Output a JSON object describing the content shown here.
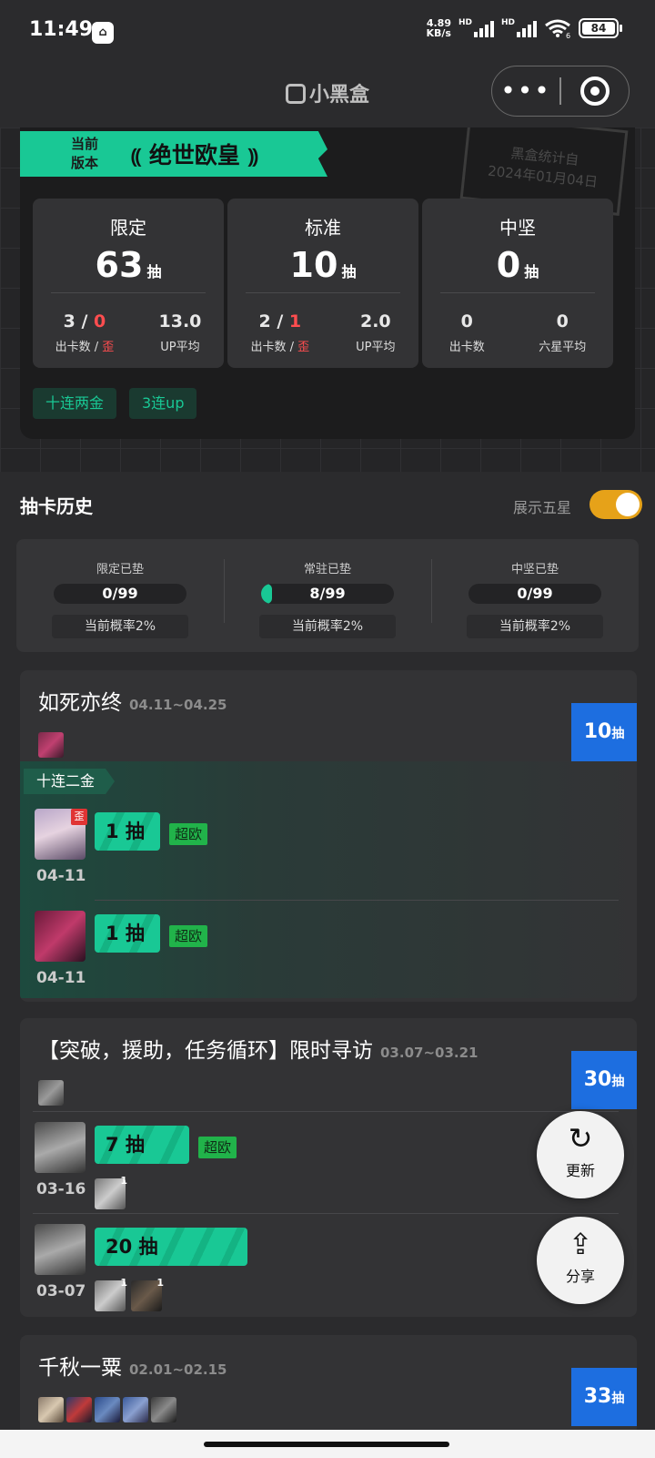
{
  "status_bar": {
    "time": "11:49",
    "app_icon": "小黑盒-icon",
    "net_speed_value": "4.89",
    "net_speed_unit": "KB/s",
    "signal_label_1": "HD",
    "signal_label_2": "HD",
    "wifi_suffix": "6",
    "battery": "84"
  },
  "nav": {
    "title": "小黑盒",
    "more_label": "•••"
  },
  "hero": {
    "stamp_line1": "黑盒统计自",
    "stamp_line2": "2024年01月04日",
    "version_label_1": "当前",
    "version_label_2": "版本",
    "version_title": "绝世欧皇",
    "cards": [
      {
        "name": "限定",
        "count": "63",
        "unit": "抽",
        "left_num_a": "3",
        "left_sep": " / ",
        "left_num_b": "0",
        "left_label_a": "出卡数 / ",
        "left_label_b": "歪",
        "right_num": "13.0",
        "right_label": "UP平均"
      },
      {
        "name": "标准",
        "count": "10",
        "unit": "抽",
        "left_num_a": "2",
        "left_sep": " / ",
        "left_num_b": "1",
        "left_label_a": "出卡数 / ",
        "left_label_b": "歪",
        "right_num": "2.0",
        "right_label": "UP平均"
      },
      {
        "name": "中坚",
        "count": "0",
        "unit": "抽",
        "left_num_a": "0",
        "left_label_a": "出卡数",
        "right_num": "0",
        "right_label": "六星平均"
      }
    ],
    "tags": [
      "十连两金",
      "3连up"
    ]
  },
  "history": {
    "title": "抽卡历史",
    "toggle_label": "展示五星",
    "toggle_on": true
  },
  "pity": [
    {
      "title": "限定已垫",
      "value": "0/99",
      "progress": 0,
      "rate": "当前概率2%"
    },
    {
      "title": "常驻已垫",
      "value": "8/99",
      "progress": 0.08,
      "rate": "当前概率2%"
    },
    {
      "title": "中坚已垫",
      "value": "0/99",
      "progress": 0,
      "rate": "当前概率2%"
    }
  ],
  "pools": [
    {
      "title": "如死亦终",
      "date": "04.11~04.25",
      "count": "10",
      "unit": "抽",
      "section_tag": "十连二金",
      "entries": [
        {
          "pulls": "1 抽",
          "badge": "超欧",
          "date": "04-11",
          "off_banner": "歪"
        },
        {
          "pulls": "1 抽",
          "badge": "超欧",
          "date": "04-11"
        }
      ]
    },
    {
      "title": "【突破，援助，任务循环】限时寻访",
      "date": "03.07~03.21",
      "count": "30",
      "unit": "抽",
      "entries": [
        {
          "pulls": "7 抽",
          "badge": "超欧",
          "date": "03-16",
          "extras": [
            "1"
          ]
        },
        {
          "pulls": "20 抽",
          "date": "03-07",
          "extras": [
            "1",
            "1"
          ]
        }
      ]
    },
    {
      "title": "千秋一粟",
      "date": "02.01~02.15",
      "count": "33",
      "unit": "抽"
    }
  ],
  "fabs": {
    "refresh_label": "更新",
    "share_label": "分享"
  },
  "colors": {
    "accent": "#19c895",
    "count_badge": "#1d6ee0",
    "toggle": "#e6a219",
    "off_banner": "#e03434"
  }
}
